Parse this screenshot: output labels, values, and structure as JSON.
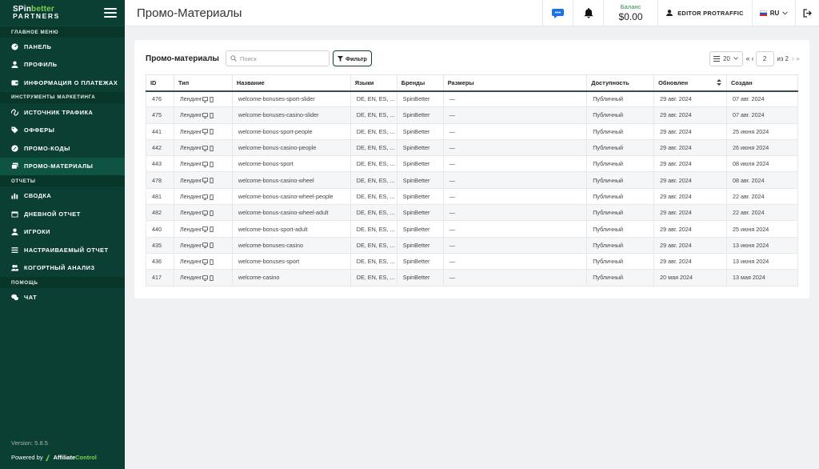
{
  "sidebar": {
    "logo": {
      "line1a": "SPin",
      "line1b": "better",
      "line2": "PARTNERS"
    },
    "sections": [
      {
        "title": "ГЛАВНОЕ МЕНЮ",
        "items": [
          {
            "label": "ПАНЕЛЬ",
            "icon": "dashboard-icon"
          },
          {
            "label": "ПРОФИЛЬ",
            "icon": "user-icon"
          },
          {
            "label": "ИНФОРМАЦИЯ О ПЛАТЕЖАХ",
            "icon": "wallet-icon"
          }
        ]
      },
      {
        "title": "ИНСТРУМЕНТЫ МАРКЕТИНГА",
        "items": [
          {
            "label": "ИСТОЧНИК ТРАФИКА",
            "icon": "link-icon"
          },
          {
            "label": "ОФФЕРЫ",
            "icon": "tags-icon"
          },
          {
            "label": "ПРОМО-КОДЫ",
            "icon": "percent-icon"
          },
          {
            "label": "ПРОМО-МАТЕРИАЛЫ",
            "icon": "images-icon",
            "active": true
          }
        ]
      },
      {
        "title": "ОТЧЕТЫ",
        "items": [
          {
            "label": "СВОДКА",
            "icon": "bar-chart-icon"
          },
          {
            "label": "ДНЕВНОЙ ОТЧЕТ",
            "icon": "calendar-icon"
          },
          {
            "label": "ИГРОКИ",
            "icon": "user-icon"
          },
          {
            "label": "НАСТРАИВАЕМЫЙ ОТЧЕТ",
            "icon": "sliders-icon"
          },
          {
            "label": "КОГОРТНЫЙ АНАЛИЗ",
            "icon": "users-icon"
          }
        ]
      },
      {
        "title": "ПОМОЩЬ",
        "items": [
          {
            "label": "ЧАТ",
            "icon": "chat-icon"
          }
        ]
      }
    ],
    "version": "Version: 5.8.5",
    "powered_by": "Powered by",
    "brand_a": "Affiliate",
    "brand_b": "Control"
  },
  "topbar": {
    "title": "Промо-Материалы",
    "balance_label": "Баланс",
    "balance_value": "$0.00",
    "user": "EDITOR PROTRAFFIC",
    "lang": "RU"
  },
  "card": {
    "title": "Промо-материалы",
    "search_placeholder": "Поиск",
    "filter_label": "Фильтр",
    "per_page": "20",
    "page": "2",
    "of_pages": "из 2"
  },
  "table": {
    "columns": [
      "ID",
      "Тип",
      "Название",
      "Языки",
      "Бренды",
      "Размеры",
      "Доступность",
      "Обновлен",
      "Создан"
    ],
    "rows": [
      [
        "476",
        "Лендинг",
        "welcome-bonuses-sport-slider",
        "DE, EN, ES, ...",
        "SpinBetter",
        "—",
        "Публичный",
        "29 авг. 2024",
        "07 авг. 2024"
      ],
      [
        "475",
        "Лендинг",
        "welcome-bonuses-casino-slider",
        "DE, EN, ES, ...",
        "SpinBetter",
        "—",
        "Публичный",
        "29 авг. 2024",
        "07 авг. 2024"
      ],
      [
        "441",
        "Лендинг",
        "welcome-bonus-sport-people",
        "DE, EN, ES, ...",
        "SpinBetter",
        "—",
        "Публичный",
        "29 авг. 2024",
        "25 июня 2024"
      ],
      [
        "442",
        "Лендинг",
        "welcome-bonus-casino-people",
        "DE, EN, ES, ...",
        "SpinBetter",
        "—",
        "Публичный",
        "29 авг. 2024",
        "26 июня 2024"
      ],
      [
        "443",
        "Лендинг",
        "welcome-bonus-sport",
        "DE, EN, ES, ...",
        "SpinBetter",
        "—",
        "Публичный",
        "29 авг. 2024",
        "08 июля 2024"
      ],
      [
        "478",
        "Лендинг",
        "welcome-bonus-casino-wheel",
        "DE, EN, ES, ...",
        "SpinBetter",
        "—",
        "Публичный",
        "29 авг. 2024",
        "08 авг. 2024"
      ],
      [
        "481",
        "Лендинг",
        "welcome-bonus-casino-wheel-people",
        "DE, EN, ES, ...",
        "SpinBetter",
        "—",
        "Публичный",
        "29 авг. 2024",
        "22 авг. 2024"
      ],
      [
        "482",
        "Лендинг",
        "welcome-bonus-casino-wheel-adult",
        "DE, EN, ES, ...",
        "SpinBetter",
        "—",
        "Публичный",
        "29 авг. 2024",
        "22 авг. 2024"
      ],
      [
        "440",
        "Лендинг",
        "welcome-bonus-sport-adult",
        "DE, EN, ES, ...",
        "SpinBetter",
        "—",
        "Публичный",
        "29 авг. 2024",
        "25 июня 2024"
      ],
      [
        "435",
        "Лендинг",
        "welcome-bonuses-casino",
        "DE, EN, ES, ...",
        "SpinBetter",
        "—",
        "Публичный",
        "29 авг. 2024",
        "13 июня 2024"
      ],
      [
        "436",
        "Лендинг",
        "welcome-bonuses-sport",
        "DE, EN, ES, ...",
        "SpinBetter",
        "—",
        "Публичный",
        "29 авг. 2024",
        "13 июня 2024"
      ],
      [
        "417",
        "Лендинг",
        "welcome-casino",
        "DE, EN, ES, ...",
        "SpinBetter",
        "—",
        "Публичный",
        "20 мая 2024",
        "13 мая 2024"
      ]
    ]
  },
  "colors": {
    "sidebar_bg": "#0b3f33",
    "accent_green": "#7ed04f",
    "chat_icon": "#1a73e8"
  }
}
